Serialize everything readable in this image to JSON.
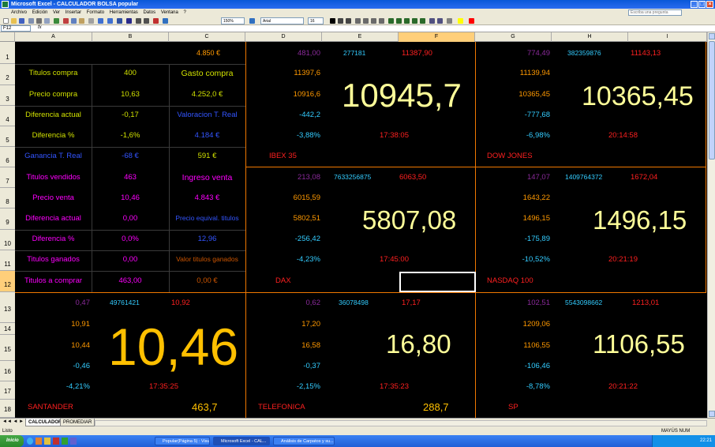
{
  "window": {
    "title": "Microsoft Excel - CALCULADOR BOLSA popular"
  },
  "menu": [
    "Archivo",
    "Edición",
    "Ver",
    "Insertar",
    "Formato",
    "Herramientas",
    "Datos",
    "Ventana",
    "?"
  ],
  "help_placeholder": "Escriba una pregunta",
  "toolbar": {
    "zoom": "150%",
    "font": "Arial",
    "font_size": "16"
  },
  "formula_bar": {
    "name_box": "F12"
  },
  "columns": [
    "A",
    "B",
    "C",
    "D",
    "E",
    "F",
    "G",
    "H",
    "I"
  ],
  "active_column": "F",
  "rows": [
    "1",
    "2",
    "3",
    "4",
    "5",
    "6",
    "7",
    "8",
    "9",
    "10",
    "11",
    "12",
    "13",
    "14",
    "15",
    "16",
    "17",
    "18"
  ],
  "active_row": "12",
  "left_panel": {
    "c1": "4.850 €",
    "titulos_compra_label": "Titulos compra",
    "titulos_compra": "400",
    "gasto_compra_label": "Gasto compra",
    "gasto_compra": "4.252,0 €",
    "precio_compra_label": "Precio compra",
    "precio_compra": "10,63",
    "diferencia_actual_label": "Diferencia actual",
    "diferencia_actual": "-0,17",
    "valoracion_label": "Valoracion  T. Real",
    "valoracion": "4.184 €",
    "diferencia_pct_label": "Diferencia  %",
    "diferencia_pct": "-1,6%",
    "ganancia_label": "Ganancia T. Real",
    "ganancia": "-68 €",
    "ganancia_c": "591 €",
    "titulos_vendidos_label": "Titulos vendidos",
    "titulos_vendidos": "463",
    "ingreso_venta_label": "Ingreso venta",
    "ingreso_venta": "4.843 €",
    "precio_venta_label": "Precio venta",
    "precio_venta": "10,46",
    "diferencia_actual2_label": "Diferencia actual",
    "diferencia_actual2": "0,00",
    "precio_equiv_label": "Precio equival. titulos",
    "precio_equiv": "12,96",
    "diferencia_pct2_label": "Diferencia %",
    "diferencia_pct2": "0,0%",
    "titulos_ganados_label": "Titulos ganados",
    "titulos_ganados": "0,00",
    "valor_titulos_label": "Valor titulos ganados",
    "valor_titulos": "0,00 €",
    "titulos_comprar_label": "Titulos a comprar",
    "titulos_comprar": "463,00"
  },
  "tickers": {
    "ibex": {
      "r1": "481,00",
      "volume": "277181",
      "high": "11387,90",
      "v2": "11397,6",
      "v3": "10916,6",
      "change": "-442,2",
      "pct": "-3,88%",
      "price": "10945,7",
      "time": "17:38:05",
      "name": "IBEX 35"
    },
    "dow": {
      "r1": "774,49",
      "volume": "382359876",
      "high": "11143,13",
      "v2": "11139,94",
      "v3": "10365,45",
      "change": "-777,68",
      "pct": "-6,98%",
      "price": "10365,45",
      "time": "20:14:58",
      "name": "DOW JONES"
    },
    "dax": {
      "r1": "213,08",
      "volume": "7633256875",
      "high": "6063,50",
      "v2": "6015,59",
      "v3": "5802,51",
      "change": "-256,42",
      "pct": "-4,23%",
      "price": "5807,08",
      "time": "17:45:00",
      "name": "DAX"
    },
    "nasdaq": {
      "r1": "147,07",
      "volume": "1409764372",
      "high": "1672,04",
      "v2": "1643,22",
      "v3": "1496,15",
      "change": "-175,89",
      "pct": "-10,52%",
      "price": "1496,15",
      "time": "20:21:19",
      "name": "NASDAQ 100"
    },
    "santander": {
      "r1": "0,47",
      "volume": "49761421",
      "high": "10,92",
      "v2": "10,91",
      "v3": "10,44",
      "change": "-0,46",
      "pct": "-4,21%",
      "price": "10,46",
      "time": "17:35:25",
      "name": "SANTANDER",
      "total": "463,7"
    },
    "telefonica": {
      "r1": "0,62",
      "volume": "36078498",
      "high": "17,17",
      "v2": "17,20",
      "v3": "16,58",
      "change": "-0,37",
      "pct": "-2,15%",
      "price": "16,80",
      "time": "17:35:23",
      "name": "TELEFONICA",
      "total": "288,7"
    },
    "sp": {
      "r1": "102,51",
      "volume": "5543098662",
      "high": "1213,01",
      "v2": "1209,06",
      "v3": "1106,55",
      "change": "-106,46",
      "pct": "-8,78%",
      "price": "1106,55",
      "time": "20:21:22",
      "name": "SP"
    }
  },
  "sheet_tabs": [
    "CALCULADORA",
    "PROMEDIAR"
  ],
  "status": {
    "left": "Listo",
    "right": "MAYÚS  NUM"
  },
  "taskbar": {
    "start": "Inicio",
    "tasks": [
      "Popular(Página 5) : Visua...",
      "Microsoft Excel - CAL...",
      "Análisis de Carpatos y su..."
    ],
    "clock": "22:21"
  },
  "colors": {
    "label_green": "#e6e600",
    "label_blue": "#3355ff",
    "orange": "#ff9900",
    "magenta": "#ff00ff",
    "cyan": "#33ccff",
    "red": "#ff2020",
    "purple": "#8a2a9a",
    "big": "#ffff99",
    "gold": "#ffc000"
  }
}
